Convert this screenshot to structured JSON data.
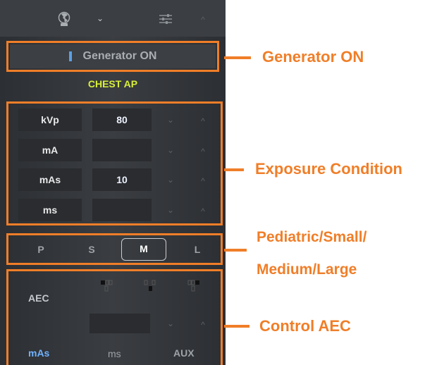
{
  "topbar": {
    "radiation_icon": "radiation-icon",
    "menu_chevron": "chevron-down-icon",
    "settings_icon": "sliders-icon",
    "collapse_chevron": "chevron-up-icon"
  },
  "generator": {
    "status_text": "Generator ON",
    "indicator_icon": "status-bar-icon"
  },
  "protocol": {
    "name": "CHEST AP"
  },
  "exposure": {
    "rows": [
      {
        "label": "kVp",
        "value": "80"
      },
      {
        "label": "mA",
        "value": ""
      },
      {
        "label": "mAs",
        "value": "10"
      },
      {
        "label": "ms",
        "value": ""
      }
    ]
  },
  "patient_size": {
    "options": [
      "P",
      "S",
      "M",
      "L"
    ],
    "selected": "M"
  },
  "aec": {
    "label": "AEC",
    "value": "",
    "modes": [
      "mAs",
      "ms",
      "AUX"
    ],
    "selected_mode": "mAs"
  },
  "callouts": {
    "generator": "Generator ON",
    "exposure": "Exposure Condition",
    "size_line1": "Pediatric/Small/",
    "size_line2": "Medium/Large",
    "aec": "Control AEC"
  },
  "colors": {
    "accent": "#f07e28",
    "protocol_text": "#d8ef3a",
    "panel": "#35383c"
  }
}
